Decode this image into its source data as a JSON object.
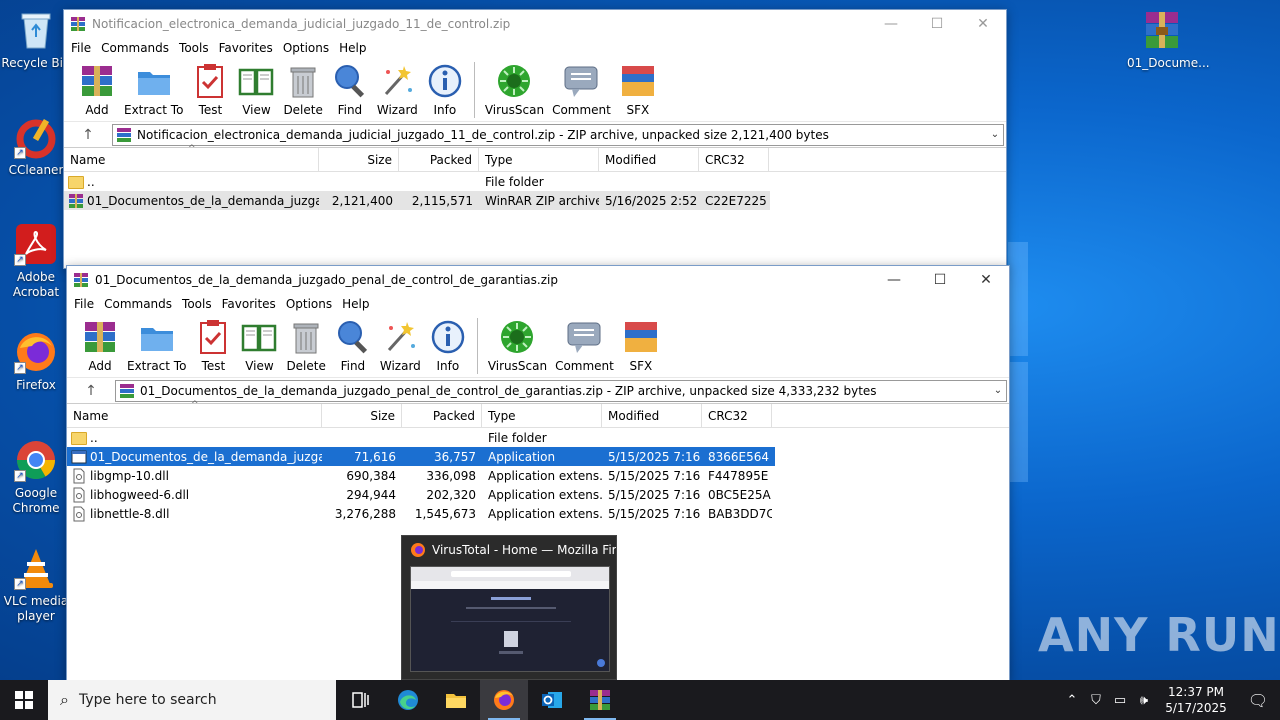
{
  "desktop_icons": [
    {
      "label": "Recycle Bin",
      "icon": "recycle-bin-icon"
    },
    {
      "label": "CCleaner",
      "icon": "ccleaner-icon"
    },
    {
      "label": "Adobe Acrobat",
      "icon": "adobe-acrobat-icon"
    },
    {
      "label": "Firefox",
      "icon": "firefox-icon"
    },
    {
      "label": "Google Chrome",
      "icon": "chrome-icon"
    },
    {
      "label": "VLC media player",
      "icon": "vlc-icon"
    },
    {
      "label": "01_Docume...",
      "icon": "winrar-archive-icon"
    }
  ],
  "menu": [
    "File",
    "Commands",
    "Tools",
    "Favorites",
    "Options",
    "Help"
  ],
  "toolbar": [
    "Add",
    "Extract To",
    "Test",
    "View",
    "Delete",
    "Find",
    "Wizard",
    "Info",
    "VirusScan",
    "Comment",
    "SFX"
  ],
  "columns": {
    "name": "Name",
    "size": "Size",
    "packed": "Packed",
    "type": "Type",
    "modified": "Modified",
    "crc": "CRC32"
  },
  "window1": {
    "title": "Notificacion_electronica_demanda_judicial_juzgado_11_de_control.zip",
    "address": "Notificacion_electronica_demanda_judicial_juzgado_11_de_control.zip - ZIP archive, unpacked size 2,121,400 bytes",
    "rows": [
      {
        "name": "..",
        "size": "",
        "packed": "",
        "type": "File folder",
        "modified": "",
        "crc": ""
      },
      {
        "name": "01_Documentos_de_la_demanda_juzgado...",
        "size": "2,121,400",
        "packed": "2,115,571",
        "type": "WinRAR ZIP archive",
        "modified": "5/16/2025 2:52 ...",
        "crc": "C22E7225"
      }
    ]
  },
  "window2": {
    "title": "01_Documentos_de_la_demanda_juzgado_penal_de_control_de_garantias.zip",
    "address": "01_Documentos_de_la_demanda_juzgado_penal_de_control_de_garantias.zip - ZIP archive, unpacked size 4,333,232 bytes",
    "rows": [
      {
        "name": "..",
        "size": "",
        "packed": "",
        "type": "File folder",
        "modified": "",
        "crc": ""
      },
      {
        "name": "01_Documentos_de_la_demanda_juzgado...",
        "size": "71,616",
        "packed": "36,757",
        "type": "Application",
        "modified": "5/15/2025 7:16 ...",
        "crc": "8366E564"
      },
      {
        "name": "libgmp-10.dll",
        "size": "690,384",
        "packed": "336,098",
        "type": "Application extens...",
        "modified": "5/15/2025 7:16 ...",
        "crc": "F447895E"
      },
      {
        "name": "libhogweed-6.dll",
        "size": "294,944",
        "packed": "202,320",
        "type": "Application extens...",
        "modified": "5/15/2025 7:16 ...",
        "crc": "0BC5E25A"
      },
      {
        "name": "libnettle-8.dll",
        "size": "3,276,288",
        "packed": "1,545,673",
        "type": "Application extens...",
        "modified": "5/15/2025 7:16 ...",
        "crc": "BAB3DD7C"
      }
    ]
  },
  "preview": {
    "title": "VirusTotal - Home — Mozilla Fir..."
  },
  "taskbar": {
    "search_placeholder": "Type here to search",
    "time": "12:37 PM",
    "date": "5/17/2025"
  },
  "watermark": "ANY RUN"
}
